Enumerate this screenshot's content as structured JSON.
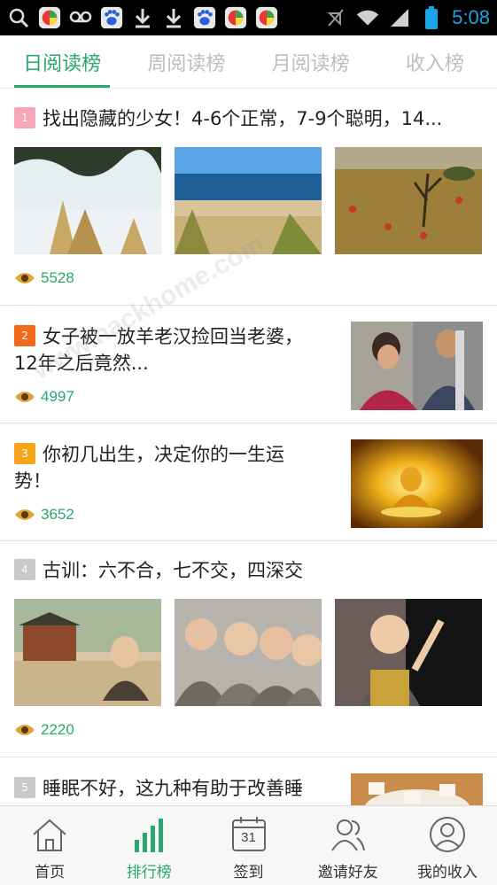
{
  "status_bar": {
    "time": "5:08",
    "icons": [
      "search-icon",
      "app-icon",
      "voicemail-icon",
      "baidu-paw-icon",
      "download-icon",
      "download-icon",
      "baidu-paw-icon",
      "app-icon",
      "app-icon",
      "mute-icon",
      "wifi-icon",
      "signal-icon",
      "battery-icon"
    ]
  },
  "tabs": [
    {
      "label": "日阅读榜",
      "active": true
    },
    {
      "label": "周阅读榜",
      "active": false
    },
    {
      "label": "月阅读榜",
      "active": false
    },
    {
      "label": "收入榜",
      "active": false
    }
  ],
  "articles": [
    {
      "rank": "1",
      "rank_color": "#f7a6b8",
      "title": "找出隐藏的少女！4-6个正常，7-9个聪明，14...",
      "views": "5528",
      "layout": "three-images"
    },
    {
      "rank": "2",
      "rank_color": "#f26b1d",
      "title": "女子被一放羊老汉捡回当老婆，12年之后竟然...",
      "views": "4997",
      "layout": "side-image"
    },
    {
      "rank": "3",
      "rank_color": "#f5a31a",
      "title": "你初几出生，决定你的一生运势！",
      "views": "3652",
      "layout": "side-image"
    },
    {
      "rank": "4",
      "rank_color": "#c9c9c9",
      "title": "古训：六不合，七不交，四深交",
      "views": "2220",
      "layout": "three-images"
    },
    {
      "rank": "5",
      "rank_color": "#c9c9c9",
      "title": "睡眠不好，这九种有助于改善睡眠的中药植物",
      "layout": "side-image"
    }
  ],
  "bottom_nav": [
    {
      "label": "首页",
      "icon": "home-icon",
      "active": false
    },
    {
      "label": "排行榜",
      "icon": "bar-chart-icon",
      "active": true
    },
    {
      "label": "签到",
      "icon": "calendar-icon",
      "active": false,
      "badge": "31"
    },
    {
      "label": "邀请好友",
      "icon": "users-icon",
      "active": false
    },
    {
      "label": "我的收入",
      "icon": "user-circle-icon",
      "active": false
    }
  ],
  "colors": {
    "accent": "#2aa76f"
  }
}
